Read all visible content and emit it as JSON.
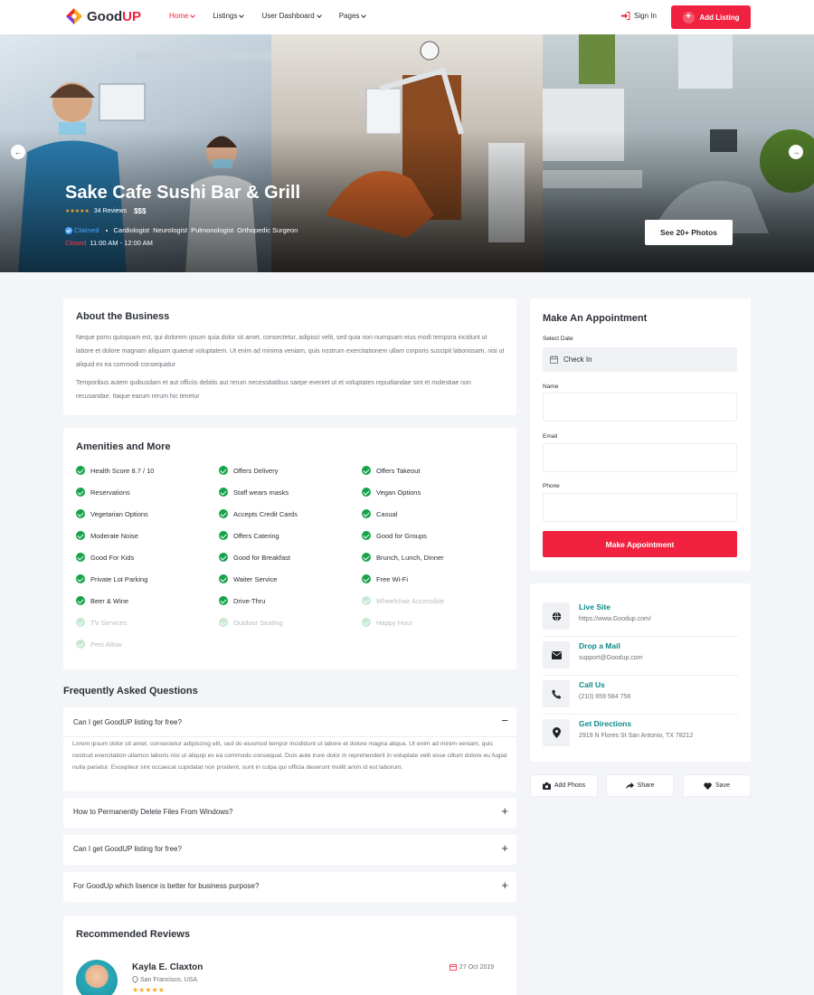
{
  "brand": {
    "name_a": "Good",
    "name_b": "UP"
  },
  "nav": [
    {
      "label": "Home"
    },
    {
      "label": "Listings"
    },
    {
      "label": "User Dashboard"
    },
    {
      "label": "Pages"
    }
  ],
  "header": {
    "signin": "Sign In",
    "add_listing": "Add Listing"
  },
  "hero": {
    "title": "Sake Cafe Sushi Bar & Grill",
    "stars": "★★★★★",
    "reviews": "34 Reviews",
    "price": "$$$",
    "claimed": "Claimed",
    "tags": [
      "Cardiologist",
      "Neurologist",
      "Pulmonologist",
      "Orthopedic Surgeon"
    ],
    "status": "Closed",
    "hours": "11:00 AM - 12:00 AM",
    "photos_button": "See 20+ Photos"
  },
  "about": {
    "title": "About the Business",
    "p1": "Neque porro quisquam est, qui dolorem ipsum quia dolor sit amet, consectetur, adipisci velit, sed quia non numquam eius modi tempora incidunt ut labore et dolore magnam aliquam quaerat voluptatem. Ut enim ad minima veniam, quis nostrum exercitationem ullam corporis suscipit laboriosam, nisi ut aliquid ex ea commodi consequatur",
    "p2": "Temporibus autem quibusdam et aut officiis debitis aut rerum necessitatibus saepe eveniet ut et voluptates repudiandae sint et molestiae non recusandae. Itaque earum rerum hic tenetur"
  },
  "amenities": {
    "title": "Amenities and More",
    "items": [
      {
        "label": "Health Score 8.7 / 10",
        "on": true
      },
      {
        "label": "Offers Delivery",
        "on": true
      },
      {
        "label": "Offers Takeout",
        "on": true
      },
      {
        "label": "Reservations",
        "on": true
      },
      {
        "label": "Staff wears masks",
        "on": true
      },
      {
        "label": "Vegan Options",
        "on": true
      },
      {
        "label": "Vegetarian Options",
        "on": true
      },
      {
        "label": "Accepts Credit Cards",
        "on": true
      },
      {
        "label": "Casual",
        "on": true
      },
      {
        "label": "Moderate Noise",
        "on": true
      },
      {
        "label": "Offers Catering",
        "on": true
      },
      {
        "label": "Good for Groups",
        "on": true
      },
      {
        "label": "Good For Kids",
        "on": true
      },
      {
        "label": "Good for Breakfast",
        "on": true
      },
      {
        "label": "Brunch, Lunch, Dinner",
        "on": true
      },
      {
        "label": "Private Lot Parking",
        "on": true
      },
      {
        "label": "Waiter Service",
        "on": true
      },
      {
        "label": "Free Wi-Fi",
        "on": true
      },
      {
        "label": "Beer & Wine",
        "on": true
      },
      {
        "label": "Drive-Thru",
        "on": true
      },
      {
        "label": "Wheelchair Accessible",
        "on": false
      },
      {
        "label": "TV Services",
        "on": false
      },
      {
        "label": "Outdoor Seating",
        "on": false
      },
      {
        "label": "Happy Hour",
        "on": false
      },
      {
        "label": "Pets Allow",
        "on": false
      }
    ]
  },
  "faq": {
    "title": "Frequently Asked Questions",
    "items": [
      {
        "q": "Can I get GoodUP listing for free?",
        "a": "Lorem ipsum dolor sit amet, consectetur adipiscing elit, sed do eiusmod tempor incididunt ut labore et dolore magna aliqua. Ut enim ad minim veniam, quis nostrud exercitation ullamco laboris nisi ut aliquip ex ea commodo consequat. Duis aute irure dolor in reprehenderit in voluptate velit esse cillum dolore eu fugiat nulla pariatur. Excepteur sint occaecat cupidatat non proident, sunt in culpa qui officia deserunt mollit anim id est laborum."
      },
      {
        "q": "How to Permanently Delete Files From Windows?"
      },
      {
        "q": "Can I get GoodUP listing for free?"
      },
      {
        "q": "For GoodUp which lisence is better for business purpose?"
      }
    ]
  },
  "reviews": {
    "title": "Recommended Reviews",
    "first": {
      "name": "Kayla E. Claxton",
      "location": "San Francisco, USA",
      "date": "27 Oct 2019",
      "stars": "★★★★★"
    }
  },
  "appointment": {
    "title": "Make An Appointment",
    "date_label": "Select Date",
    "date_value": "Check In",
    "name_label": "Name",
    "email_label": "Email",
    "phone_label": "Phone",
    "button": "Make Appointment"
  },
  "contact": [
    {
      "title": "Live Site",
      "value": "https://www.Goodup.com/",
      "icon": "globe-icon"
    },
    {
      "title": "Drop a Mail",
      "value": "support@Goodup.com",
      "icon": "mail-icon"
    },
    {
      "title": "Call Us",
      "value": "(210) 659 584 756",
      "icon": "phone-icon"
    },
    {
      "title": "Get Directions",
      "value": "2919 N Flores St San Antonio, TX 78212",
      "icon": "map-pin-icon"
    }
  ],
  "actions": {
    "photos": "Add Phoos",
    "share": "Share",
    "save": "Save"
  },
  "colors": {
    "accent": "#f0223f",
    "teal": "#0f8a8a",
    "check": "#16a34a"
  }
}
